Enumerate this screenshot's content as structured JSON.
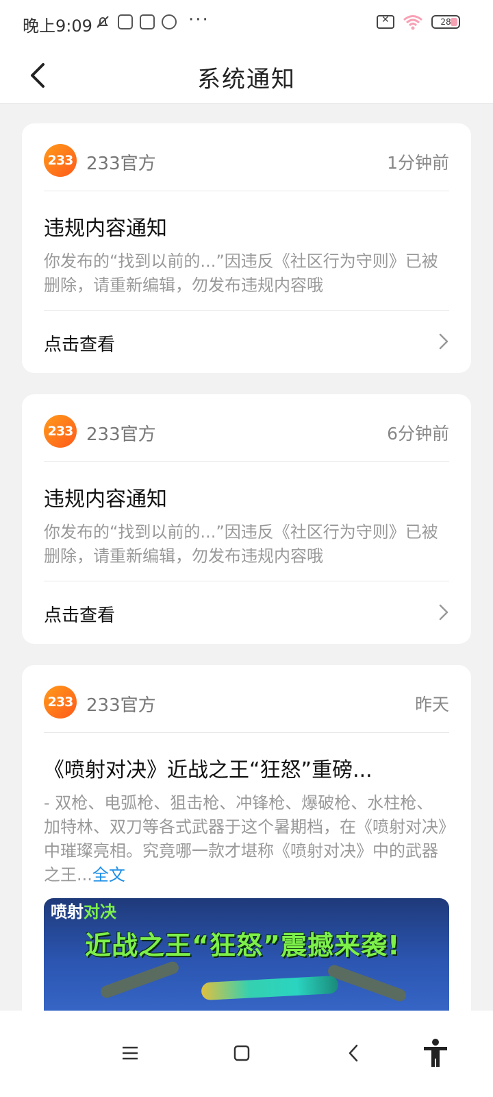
{
  "status_bar": {
    "time": "晚上9:09",
    "overflow": "···",
    "battery": "28",
    "battery_level_percent": 28
  },
  "header": {
    "title": "系统通知"
  },
  "notifications": [
    {
      "avatar_text": "233",
      "sender": "233官方",
      "time": "1分钟前",
      "title": "违规内容通知",
      "body": "你发布的“找到以前的...”因违反《社区行为守则》已被删除，请重新编辑，勿发布违规内容哦",
      "action": "点击查看"
    },
    {
      "avatar_text": "233",
      "sender": "233官方",
      "time": "6分钟前",
      "title": "违规内容通知",
      "body": "你发布的“找到以前的...”因违反《社区行为守则》已被删除，请重新编辑，勿发布违规内容哦",
      "action": "点击查看"
    },
    {
      "avatar_text": "233",
      "sender": "233官方",
      "time": "昨天",
      "title": "《喷射对决》近战之王“狂怒”重磅...",
      "body": "- 双枪、电弧枪、狙击枪、冲锋枪、爆破枪、水柱枪、加特林、双刀等各式武器于这个暑期档，在《喷射对决》中璀璨亮相。究竟哪一款才堪称《喷射对决》中的武器之王...",
      "more": "全文",
      "banner": {
        "logo_a": "喷射",
        "logo_b": "对决",
        "slogan": "近战之王“狂怒”震撼来袭!"
      }
    }
  ],
  "colors": {
    "accent_orange": "#ff7a1a",
    "link_blue": "#1e8fe6",
    "banner_green": "#7df04a"
  },
  "icons": {
    "back": "chevron-left-icon",
    "row_arrow": "chevron-right-icon",
    "nav_menu": "menu-icon",
    "nav_home": "square-home-icon",
    "nav_back": "chevron-left-icon",
    "nav_accessibility": "accessibility-icon"
  }
}
